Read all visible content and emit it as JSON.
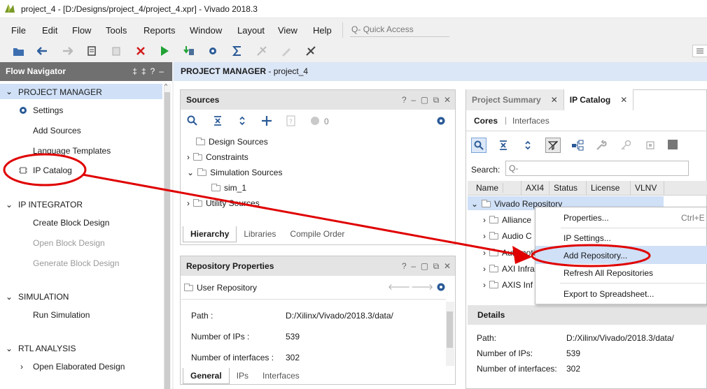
{
  "window": {
    "title": "project_4 - [D:/Designs/project_4/project_4.xpr] - Vivado 2018.3"
  },
  "menu": {
    "items": [
      "File",
      "Edit",
      "Flow",
      "Tools",
      "Reports",
      "Window",
      "Layout",
      "View",
      "Help"
    ],
    "quick_access_placeholder": "Quick Access"
  },
  "flow_navigator": {
    "title": "Flow Navigator",
    "sections": [
      {
        "label": "PROJECT MANAGER",
        "items": [
          "Settings",
          "Add Sources",
          "Language Templates",
          "IP Catalog"
        ]
      },
      {
        "label": "IP INTEGRATOR",
        "items": [
          "Create Block Design",
          "Open Block Design",
          "Generate Block Design"
        ]
      },
      {
        "label": "SIMULATION",
        "items": [
          "Run Simulation"
        ]
      },
      {
        "label": "RTL ANALYSIS",
        "items": [
          "Open Elaborated Design"
        ]
      }
    ]
  },
  "project_manager": {
    "title": "PROJECT MANAGER",
    "project": "project_4"
  },
  "sources": {
    "title": "Sources",
    "count": "0",
    "tree": [
      "Design Sources",
      "Constraints",
      "Simulation Sources",
      "sim_1",
      "Utility Sources"
    ],
    "tabs": [
      "Hierarchy",
      "Libraries",
      "Compile Order"
    ]
  },
  "repo_props": {
    "title": "Repository Properties",
    "name": "User Repository",
    "path_label": "Path :",
    "path": "D:/Xilinx/Vivado/2018.3/data/",
    "ips_label": "Number of IPs :",
    "ips": "539",
    "ifaces_label": "Number of interfaces :",
    "ifaces": "302",
    "tabs": [
      "General",
      "IPs",
      "Interfaces"
    ]
  },
  "ip_catalog": {
    "tabs": [
      "Project Summary",
      "IP Catalog"
    ],
    "subtabs": [
      "Cores",
      "Interfaces"
    ],
    "search_label": "Search:",
    "search_placeholder": "Q-",
    "columns": [
      "Name",
      "AXI4",
      "Status",
      "License",
      "VLNV"
    ],
    "sort_indicator": "^ 1",
    "root": "Vivado Repository",
    "rows": [
      "Alliance",
      "Audio C",
      "Automotive",
      "AXI Infra",
      "AXIS Inf"
    ]
  },
  "context_menu": {
    "items": [
      "Properties...",
      "IP Settings...",
      "Add Repository...",
      "Refresh All Repositories",
      "Export to Spreadsheet..."
    ],
    "shortcut": "Ctrl+E"
  },
  "details": {
    "title": "Details",
    "path_label": "Path:",
    "path": "D:/Xilinx/Vivado/2018.3/data/",
    "ips_label": "Number of IPs:",
    "ips": "539",
    "ifaces_label": "Number of interfaces:",
    "ifaces": "302"
  },
  "colors": {
    "annotation": "#e00000",
    "selection": "#cfe0f7",
    "accent": "#1f5fa8"
  }
}
